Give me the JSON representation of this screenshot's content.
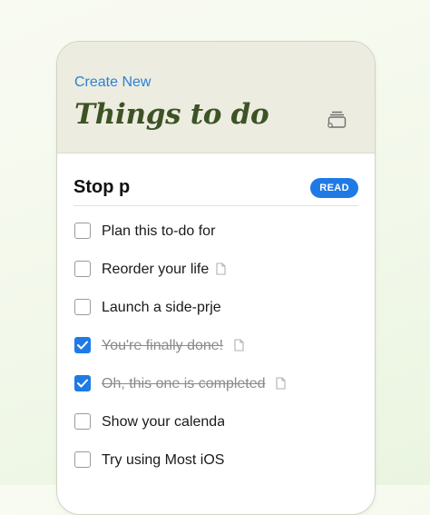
{
  "header": {
    "create_new_label": "Create New",
    "title": "Things to do",
    "stack_icon": "stack-icon"
  },
  "section": {
    "title": "Stop p",
    "badge_label": "READ"
  },
  "todos": [
    {
      "label": "Plan this to-do for",
      "checked": false,
      "has_note": false
    },
    {
      "label": "Reorder your life",
      "checked": false,
      "has_note": true
    },
    {
      "label": "Launch a side-prje",
      "checked": false,
      "has_note": false
    },
    {
      "label": "You're finally done!",
      "checked": true,
      "has_note": true
    },
    {
      "label": "Oh, this one is completed",
      "checked": true,
      "has_note": true
    },
    {
      "label": "Show your calenda",
      "checked": false,
      "has_note": false
    },
    {
      "label": "Try using Most iOS",
      "checked": false,
      "has_note": false
    }
  ],
  "colors": {
    "accent": "#1f7ae6",
    "title_green": "#3d5326",
    "header_bg": "#ecede0"
  }
}
